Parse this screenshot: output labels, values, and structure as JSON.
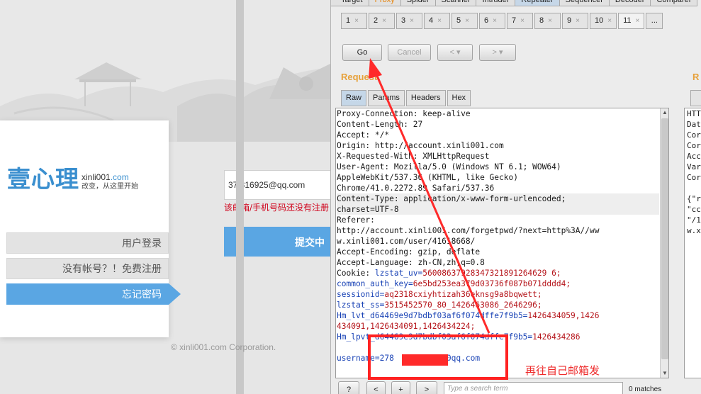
{
  "web": {
    "logo_cn": "壹心理",
    "logo_domain_main": "xinli001",
    "logo_domain_com": ".com",
    "logo_tagline": "改变，从这里开始",
    "nav": [
      {
        "label": "用户登录"
      },
      {
        "label": "没有帐号？！免费注册"
      },
      {
        "label": "忘记密码"
      }
    ],
    "email_value": "37 316925@qq.com",
    "error_text": "该邮箱/手机号码还没有注册",
    "submit_label": "提交中",
    "footer": "© xinli001.com Corporation."
  },
  "burp": {
    "main_tabs": [
      "Target",
      "Proxy",
      "Spider",
      "Scanner",
      "Intruder",
      "Repeater",
      "Sequencer",
      "Decoder",
      "Comparer"
    ],
    "sub_tabs": [
      "1",
      "2",
      "3",
      "4",
      "5",
      "6",
      "7",
      "8",
      "9",
      "10",
      "11",
      "..."
    ],
    "active_sub_tab": "11",
    "buttons": {
      "go": "Go",
      "cancel": "Cancel",
      "back": "<",
      "back_menu": "▾",
      "forward": ">",
      "forward_menu": "▾"
    },
    "request_title": "Request",
    "response_title": "R",
    "request_tabs": [
      "Raw",
      "Params",
      "Headers",
      "Hex"
    ],
    "request_lines": [
      {
        "text": "Proxy-Connection: keep-alive",
        "style": ""
      },
      {
        "text": "Content-Length: 27",
        "style": ""
      },
      {
        "text": "Accept: */*",
        "style": ""
      },
      {
        "text": "Origin: http://account.xinli001.com",
        "style": ""
      },
      {
        "text": "X-Requested-With: XMLHttpRequest",
        "style": ""
      },
      {
        "text": "User-Agent: Mozilla/5.0 (Windows NT 6.1; WOW64)",
        "style": ""
      },
      {
        "text": "AppleWebKit/537.36 (KHTML, like Gecko)",
        "style": ""
      },
      {
        "text": "Chrome/41.0.2272.89 Safari/537.36",
        "style": ""
      },
      {
        "text": "Content-Type: application/x-www-form-urlencoded;",
        "style": "hl"
      },
      {
        "text": "charset=UTF-8",
        "style": "hl"
      },
      {
        "text": "Referer:",
        "style": ""
      },
      {
        "text": "http://account.xinli001.com/forgetpwd/?next=http%3A//ww",
        "style": ""
      },
      {
        "text": "w.xinli001.com/user/41618668/",
        "style": ""
      },
      {
        "text": "Accept-Encoding: gzip, deflate",
        "style": ""
      },
      {
        "text": "Accept-Language: zh-CN,zh;q=0.8",
        "style": ""
      },
      {
        "text": "Cookie: lzstat_uv=56008637928347321891264629 6;",
        "style": "cookie"
      },
      {
        "text": "common_auth_key=6e5bd253ea379d03736f087b071dddd4;",
        "style": "cookie"
      },
      {
        "text": "sessionid=aq2318cxiyhtizah36eknsg9a8bqwett;",
        "style": "cookie"
      },
      {
        "text": "lzstat_ss=3515452570_80_1426463086_2646296;",
        "style": "cookie"
      },
      {
        "text": "Hm_lvt_d64469e9d7bdbf03af6f074dffe7f9b5=1426434059,1426",
        "style": "cookie"
      },
      {
        "text": "434091,1426434091,1426434224;",
        "style": "cookie"
      },
      {
        "text": "Hm_lpvt_d64469e9d7bdbf03af6f074dffe7f9b5=1426434286",
        "style": "cookie"
      },
      {
        "text": "",
        "style": ""
      },
      {
        "text": "username=278          40qq.com",
        "style": "blue"
      }
    ],
    "response_lines": [
      "HTT",
      "Dat",
      "Cor",
      "Cor",
      "Acc",
      "Var",
      "Cor",
      "",
      "{\"r",
      "\"cc",
      "\"/1",
      "w.x"
    ],
    "bottom": {
      "help": "?",
      "prev": "<",
      "add": "+",
      "next": ">",
      "search_placeholder": "Type a search term",
      "matches": "0 matches"
    }
  },
  "annotation": {
    "note": "再往自己邮箱发",
    "color": "#ff2222"
  }
}
